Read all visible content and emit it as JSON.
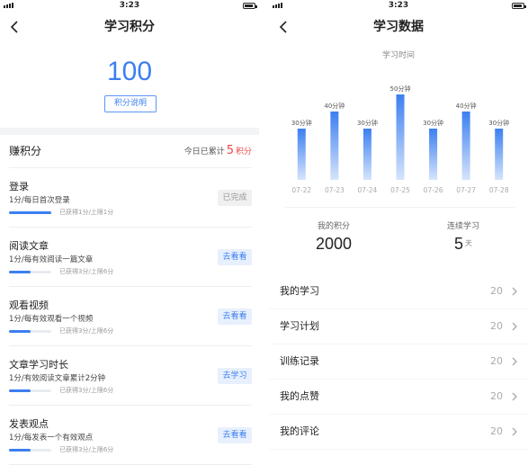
{
  "left": {
    "status": {
      "time": "3:23"
    },
    "title": "学习积分",
    "score": "100",
    "score_link": "积分说明",
    "earn": {
      "title": "赚积分",
      "today_prefix": "今日已累计",
      "today_points": "5",
      "today_unit": "积分"
    },
    "tasks": [
      {
        "name": "登录",
        "desc": "1分/每日首次登录",
        "progress": "已获得1分/上限1分",
        "fill": 1.0,
        "button": "已完成",
        "done": true
      },
      {
        "name": "阅读文章",
        "desc": "1分/每有效阅读一篇文章",
        "progress": "已获得3分/上限6分",
        "fill": 0.5,
        "button": "去看看",
        "done": false
      },
      {
        "name": "观看视频",
        "desc": "1分/每有效观看一个视频",
        "progress": "已获得3分/上限6分",
        "fill": 0.5,
        "button": "去看看",
        "done": false
      },
      {
        "name": "文章学习时长",
        "desc": "1分/有效阅读文章累计2分钟",
        "progress": "已获得3分/上限6分",
        "fill": 0.5,
        "button": "去学习",
        "done": false
      },
      {
        "name": "发表观点",
        "desc": "1分/每发表一个有效观点",
        "progress": "已获得3分/上限6分",
        "fill": 0.5,
        "button": "去看看",
        "done": false
      }
    ]
  },
  "right": {
    "status": {
      "time": "3:23"
    },
    "title": "学习数据",
    "chart_subtitle": "学习时间",
    "chart_data": {
      "type": "bar",
      "title": "学习时间",
      "categories": [
        "07-22",
        "07-23",
        "07-24",
        "07-25",
        "07-26",
        "07-27",
        "07-28"
      ],
      "values": [
        30,
        40,
        30,
        50,
        30,
        40,
        30
      ],
      "value_labels": [
        "30分钟",
        "40分钟",
        "30分钟",
        "50分钟",
        "30分钟",
        "40分钟",
        "30分钟"
      ],
      "ylim": [
        0,
        50
      ],
      "color": "#3c7ff0"
    },
    "stats": {
      "points_label": "我的积分",
      "points_value": "2000",
      "streak_label": "连续学习",
      "streak_value": "5",
      "streak_unit": "天"
    },
    "menu": [
      {
        "label": "我的学习",
        "count": "20"
      },
      {
        "label": "学习计划",
        "count": "20"
      },
      {
        "label": "训练记录",
        "count": "20"
      },
      {
        "label": "我的点赞",
        "count": "20"
      },
      {
        "label": "我的评论",
        "count": "20"
      }
    ]
  },
  "icons": {
    "back": "back-arrow-icon",
    "chevron": "chevron-right-icon",
    "signal": "signal-icon",
    "battery": "battery-icon"
  },
  "colors": {
    "accent": "#3c7ff0",
    "highlight": "#f04848"
  }
}
